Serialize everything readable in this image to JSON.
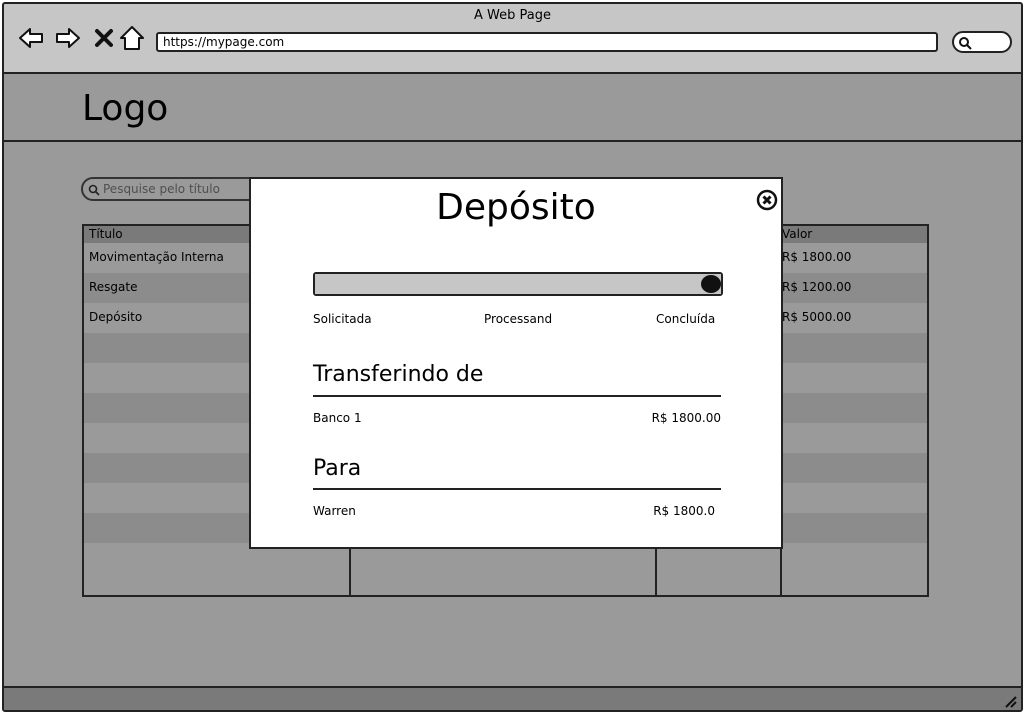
{
  "window": {
    "title": "A Web Page"
  },
  "browser": {
    "url": "https://mypage.com",
    "icons": [
      "back-arrow-icon",
      "forward-arrow-icon",
      "close-x-icon",
      "home-icon",
      "search-icon"
    ]
  },
  "header": {
    "logo": "Logo"
  },
  "search": {
    "placeholder": "Pesquise pelo título"
  },
  "table": {
    "columns": [
      "Título",
      "",
      "",
      "",
      "Valor"
    ],
    "rows": [
      {
        "title": "Movimentação Interna",
        "value": "R$ 1800.00"
      },
      {
        "title": "Resgate",
        "value": "R$ 1200.00"
      },
      {
        "title": "Depósito",
        "value": "R$ 5000.00"
      }
    ]
  },
  "modal": {
    "title": "Depósito",
    "progress": {
      "value_percent": 100
    },
    "steps": [
      "Solicitada",
      "Processand",
      "Concluída"
    ],
    "from": {
      "heading": "Transferindo de",
      "name": "Banco 1",
      "amount": "R$ 1800.00"
    },
    "to": {
      "heading": "Para",
      "name": "Warren",
      "amount": "R$ 1800.0"
    }
  },
  "colors": {
    "background": "#9a9a9a",
    "chrome": "#c6c6c6",
    "header_row": "#7a7a7a",
    "modal": "#ffffff"
  }
}
